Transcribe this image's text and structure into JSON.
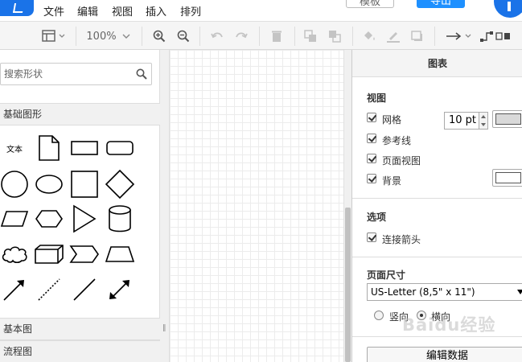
{
  "menubar": {
    "items": [
      "文件",
      "编辑",
      "视图",
      "插入",
      "排列"
    ],
    "gray_button": "模板",
    "blue_button": "导出"
  },
  "toolbar": {
    "zoom": "100%",
    "icons": [
      "format-panel-icon",
      "zoom-in-icon",
      "zoom-out-icon",
      "undo-icon",
      "redo-icon",
      "delete-icon",
      "to-front-icon",
      "to-back-icon",
      "fill-color-icon",
      "line-color-icon",
      "shadow-icon",
      "connection-arrow-icon",
      "waypoints-icon"
    ]
  },
  "sidebar": {
    "search_placeholder": "搜索形状",
    "sections": [
      "基础图形",
      "基本图",
      "流程图"
    ],
    "text_shape_label": "文本"
  },
  "panel": {
    "header": "图表",
    "view_title": "视图",
    "grid_label": "网格",
    "grid_size": "10 pt",
    "guides_label": "参考线",
    "page_view_label": "页面视图",
    "background_label": "背景",
    "options_title": "选项",
    "connection_arrows_label": "连接箭头",
    "page_size_title": "页面尺寸",
    "page_size_value": "US-Letter (8,5\" x 11\")",
    "portrait_label": "竖向",
    "landscape_label": "横向",
    "edit_data_button": "编辑数据"
  },
  "colors": {
    "accent": "#1e90ff",
    "brand": "#1a73e8",
    "grid_color_swatch": "#d9d9d9",
    "background_swatch": "#ffffff"
  },
  "watermark": "Baidu经验"
}
